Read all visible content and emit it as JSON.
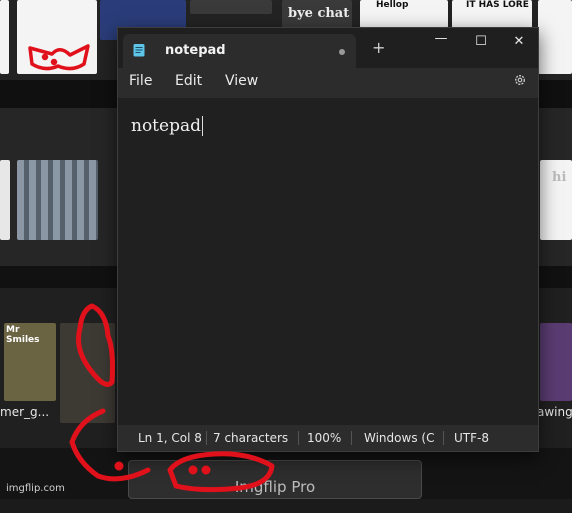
{
  "notepad": {
    "tab_title": "notepad",
    "new_tab_symbol": "+",
    "menu": [
      "File",
      "Edit",
      "View"
    ],
    "content": "notepad",
    "status": {
      "position": "Ln 1, Col 8",
      "characters": "7 characters",
      "zoom": "100%",
      "line_ending": "Windows (C",
      "encoding": "UTF-8"
    },
    "controls": {
      "minimize": "—",
      "maximize": "☐",
      "close": "✕"
    }
  },
  "background": {
    "thumb_texts": {
      "bye_chat": "bye chat",
      "hi": "hi",
      "mr_smiles": "Mr Smiles",
      "hello": "Hellop",
      "its_has_lore": "IT HAS LORE"
    },
    "captions": {
      "mer_g": "mer_g...",
      "awings": "awings"
    },
    "pro_button": "Imgflip Pro",
    "watermark": "imgflip.com"
  },
  "colors": {
    "window_bg": "#202020",
    "chrome_bg": "#2c2c2c",
    "red_marker": "#e0111b"
  }
}
